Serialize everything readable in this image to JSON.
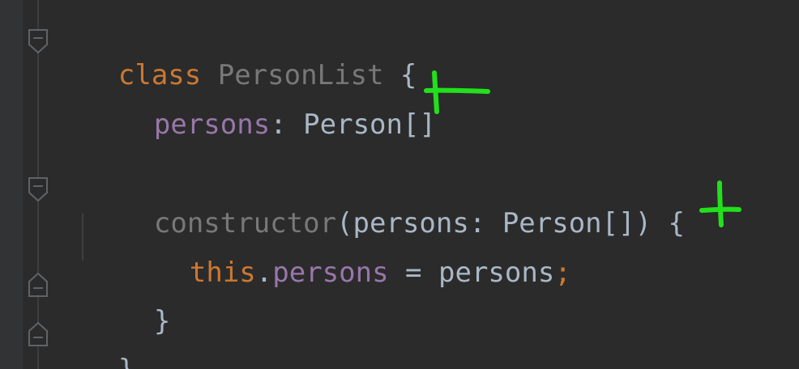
{
  "editor": {
    "lines": {
      "l1": {
        "kw": "class",
        "name": "PersonList",
        "brace": "{"
      },
      "l2": {
        "field": "persons",
        "colon": ":",
        "type": "Person[]"
      },
      "l4": {
        "ctor": "constructor",
        "open": "(",
        "param": "persons",
        "colon": ":",
        "type": "Person[]",
        "close": ")",
        "brace": "{"
      },
      "l5": {
        "this": "this",
        "dot": ".",
        "field": "persons",
        "eq": "=",
        "value": "persons",
        "semi": ";"
      },
      "l6": {
        "brace": "}"
      },
      "l7": {
        "brace": "}"
      }
    }
  },
  "theme": {
    "background": "#2b2b2b",
    "keyword": "#cc7832",
    "field": "#9876aa",
    "text": "#a9b7c6",
    "unused": "#787878",
    "annotation": "#22e01b"
  },
  "annotations": {
    "marks": [
      "pen-mark-arrow",
      "pen-mark-plus"
    ]
  }
}
